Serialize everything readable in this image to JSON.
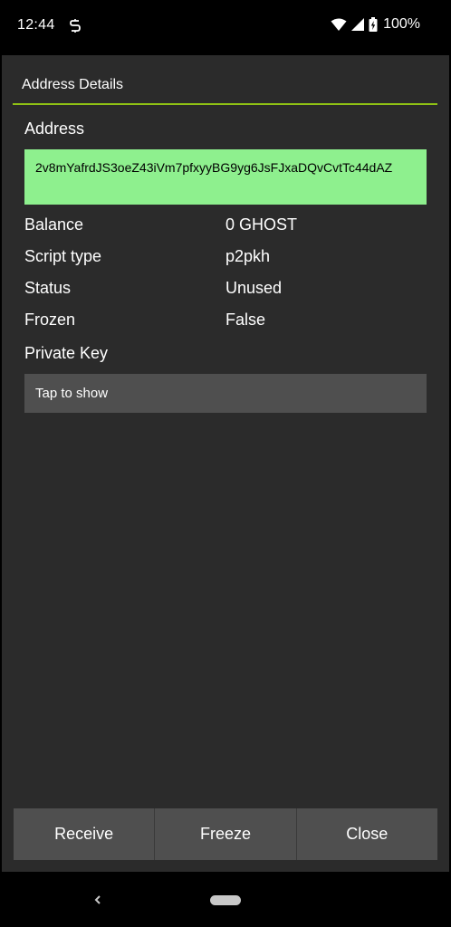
{
  "status_bar": {
    "time": "12:44",
    "app_icon": "s-notification-icon",
    "battery": "100%"
  },
  "dialog": {
    "title": "Address Details",
    "accent_color": "#8fc214",
    "address_label": "Address",
    "address_value": "2v8mYafrdJS3oeZ43iVm7pfxyyBG9yg6JsFJxaDQvCvtTc44dAZ",
    "address_bg": "#8ef08e",
    "rows": [
      {
        "key": "Balance",
        "value": "0 GHOST"
      },
      {
        "key": "Script type",
        "value": "p2pkh"
      },
      {
        "key": "Status",
        "value": "Unused"
      },
      {
        "key": "Frozen",
        "value": "False"
      }
    ],
    "private_key_label": "Private Key",
    "private_key_value": "Tap to show"
  },
  "buttons": {
    "receive": "Receive",
    "freeze": "Freeze",
    "close": "Close"
  }
}
